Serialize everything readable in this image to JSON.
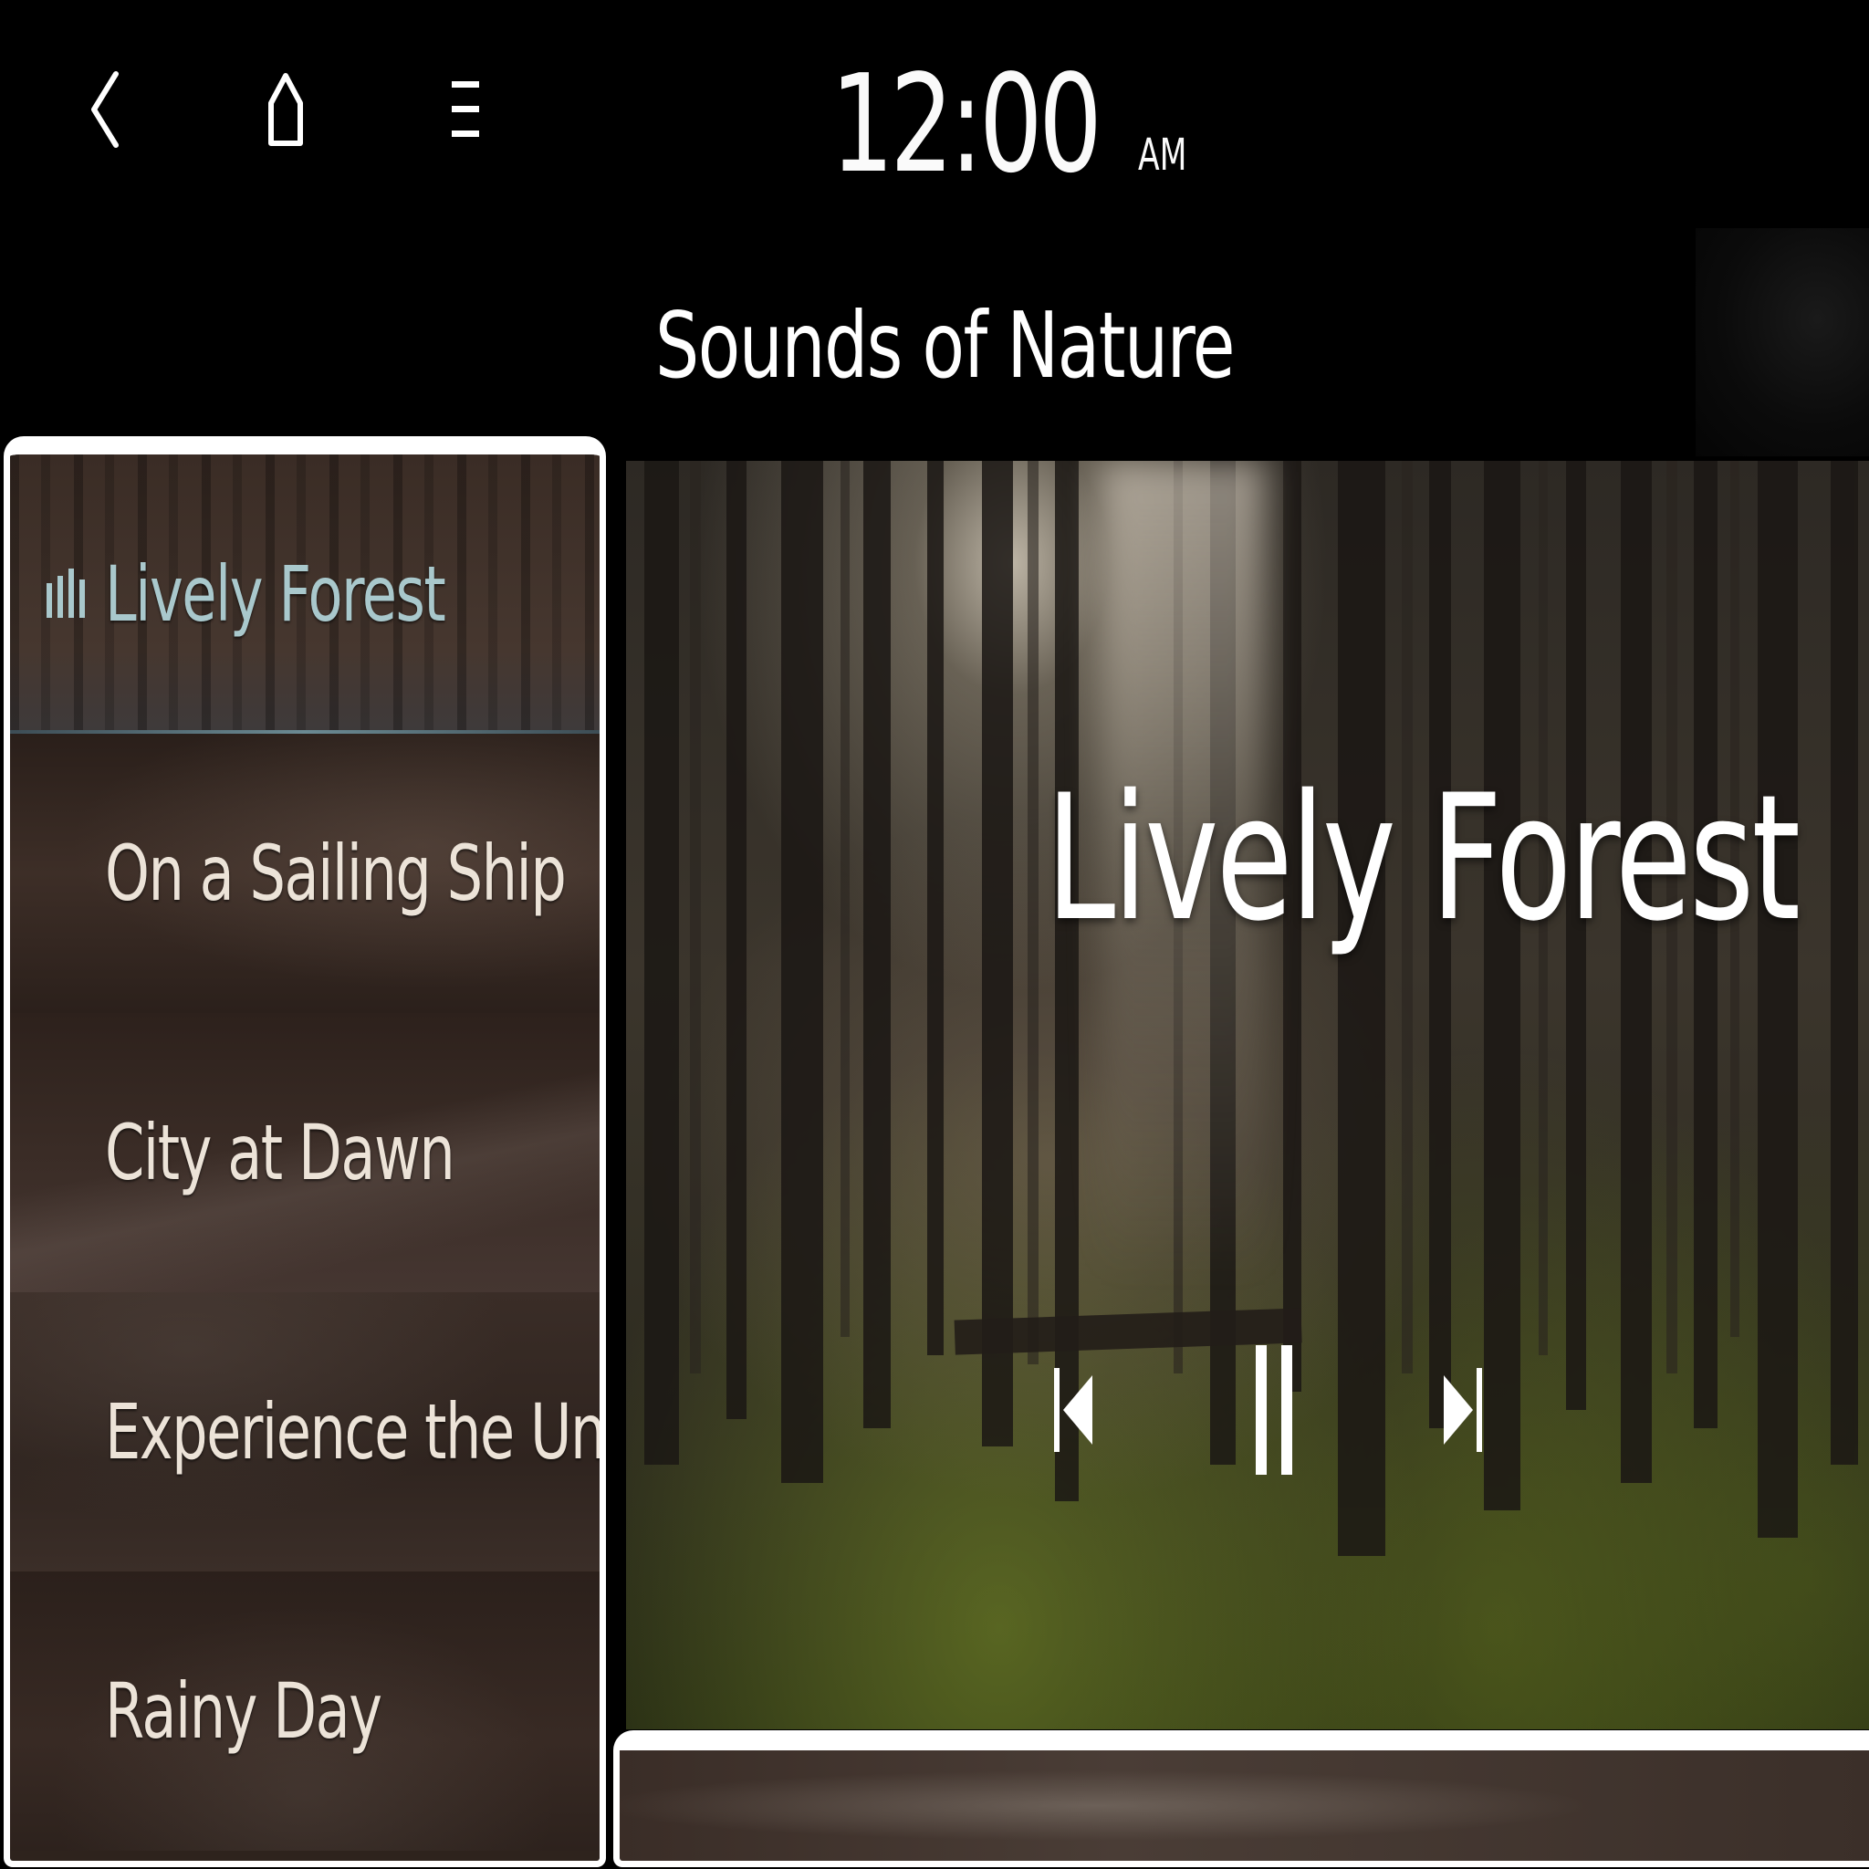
{
  "status_bar": {
    "back_icon": "chevron-left-icon",
    "home_icon": "home-icon",
    "menu_icon": "menu-icon",
    "time": "12:00",
    "ampm": "AM"
  },
  "header": {
    "title": "Sounds of Nature"
  },
  "playlist": {
    "items": [
      {
        "label": "Lively Forest",
        "active": true
      },
      {
        "label": "On a Sailing Ship",
        "active": false
      },
      {
        "label": "City at Dawn",
        "active": false
      },
      {
        "label": "Experience the Universe",
        "active": false
      },
      {
        "label": "Rainy Day",
        "active": false
      }
    ],
    "now_playing_icon": "equalizer-icon"
  },
  "now_playing": {
    "title": "Lively Forest",
    "controls": {
      "previous_icon": "skip-previous-icon",
      "pause_icon": "pause-icon",
      "next_icon": "skip-next-icon"
    }
  },
  "colors": {
    "active_track_text": "#a9c8cc",
    "track_text": "#ece3d8",
    "panel_border": "#ffffff",
    "background": "#000000"
  }
}
